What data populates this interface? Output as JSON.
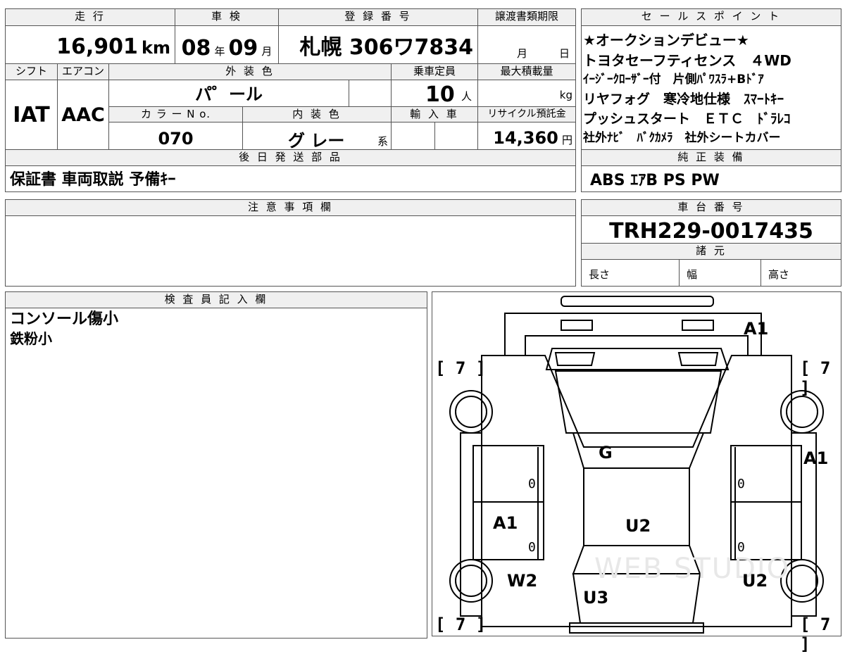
{
  "vehicle": {
    "mileage_label": "走 行",
    "mileage_value": "16,901",
    "mileage_unit": "km",
    "inspection_label": "車 検",
    "inspection_year": "08",
    "inspection_year_unit": "年",
    "inspection_month": "09",
    "inspection_month_unit": "月",
    "registration_label": "登 録 番 号",
    "registration_value": "札幌 306ワ7834",
    "transfer_doc_label": "譲渡書類期限",
    "transfer_month_unit": "月",
    "transfer_day_unit": "日",
    "shift_label": "シフト",
    "shift_value": "IAT",
    "aircon_label": "エアコン",
    "aircon_value": "AAC",
    "exterior_label": "外 装 色",
    "exterior_value": "パ゜ール",
    "capacity_label": "乗車定員",
    "capacity_value": "10",
    "capacity_unit": "人",
    "max_load_label": "最大積載量",
    "max_load_unit": "kg",
    "color_no_label": "カ ラ ー N o.",
    "color_no_value": "070",
    "interior_label": "内 装 色",
    "interior_value": "グ レー",
    "interior_suffix": "系",
    "import_label": "輸 入 車",
    "recycle_label": "リサイクル預託金",
    "recycle_value": "14,360",
    "recycle_unit": "円",
    "later_parts_label": "後 日 発 送 部 品",
    "later_parts_value": "保証書 車両取説 予備ｷｰ"
  },
  "sales": {
    "title": "セ ー ル ス ポ イ ン ト",
    "lines": [
      "★オークションデビュー★",
      "トヨタセーフティセンス　４WD",
      "ｲｰｼﾞｰｸﾛｰｻﾞｰ付　片側ﾊﾟﾜｽﾗ+Bﾄﾞｱ",
      "リヤフォグ　寒冷地仕様　ｽﾏｰﾄｷｰ",
      "プッシュスタート　ＥＴＣ　ﾄﾞﾗﾚｺ",
      "社外ﾅﾋﾞ　ﾊﾞｸｶﾒﾗ　社外シートカバー"
    ]
  },
  "equipment": {
    "title": "純 正 装 備",
    "value": "ABS  ｴｱB  PS  PW"
  },
  "notes": {
    "title": "注 意 事 項 欄",
    "value": ""
  },
  "chassis": {
    "title": "車 台 番 号",
    "value": "TRH229-0017435",
    "spec_title": "諸 元",
    "length_label": "長さ",
    "width_label": "幅",
    "height_label": "高さ"
  },
  "inspector": {
    "title": "検 査 員 記 入 欄",
    "lines": [
      "コンソール傷小",
      "鉄粉小"
    ]
  },
  "diagram": {
    "marks": {
      "front_right": "A1",
      "right_side": "A1",
      "left_door": "A1",
      "hood": "G",
      "roof": "U2",
      "left_rear": "W2",
      "right_rear": "U2",
      "rear": "U3"
    },
    "tire_brackets": [
      "[ 7 ]",
      "[ 7 ]",
      "[ 7 ]",
      "[ 7 ]"
    ],
    "zeros": [
      "0",
      "0",
      "0",
      "0"
    ],
    "watermark": "WEB STUDIO"
  }
}
